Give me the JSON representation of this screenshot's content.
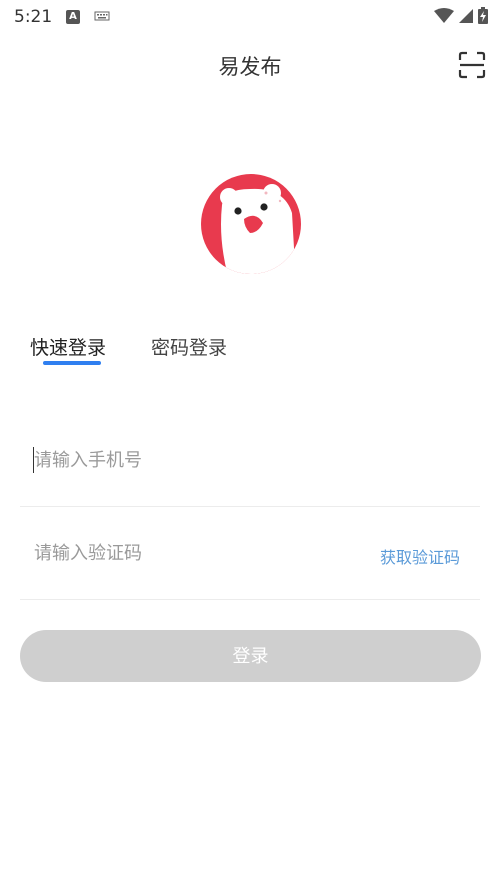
{
  "status_bar": {
    "time": "5:21",
    "icons": [
      "a-notification-icon",
      "keyboard-icon",
      "wifi-icon",
      "signal-icon",
      "battery-icon"
    ]
  },
  "header": {
    "title": "易发布",
    "scan_icon": "scan-icon"
  },
  "logo": {
    "icon": "bear-logo-icon",
    "colors": {
      "background": "#e83a4e",
      "bear": "#ffffff",
      "nose": "#e83a4e"
    }
  },
  "tabs": [
    {
      "label": "快速登录",
      "active": true
    },
    {
      "label": "密码登录",
      "active": false
    }
  ],
  "form": {
    "phone_placeholder": "请输入手机号",
    "code_placeholder": "请输入验证码",
    "get_code_label": "获取验证码",
    "login_label": "登录"
  },
  "colors": {
    "accent": "#2f7ff0",
    "link": "#5a9ad8",
    "button_disabled": "#cfcfcf"
  }
}
